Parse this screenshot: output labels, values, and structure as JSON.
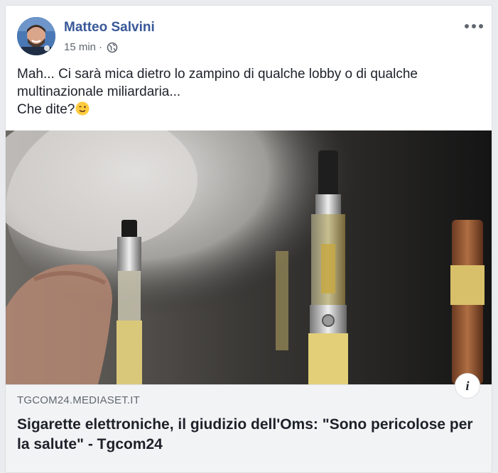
{
  "post": {
    "author": "Matteo Salvini",
    "time": "15 min",
    "separator": "·",
    "privacy_icon": "globe-icon",
    "menu_icon": "more-options-icon",
    "text_lines": [
      "Mah... Ci sarà mica dietro lo zampino di qualche lobby o di qualche",
      "multinazionale miliardaria...",
      "Che dite?"
    ],
    "emoji": "winking-face-emoji"
  },
  "link_preview": {
    "image_icon": "e-cigarette-photo",
    "info_icon": "info-icon",
    "domain": "TGCOM24.MEDIASET.IT",
    "headline": "Sigarette elettroniche, il giudizio dell'Oms: \"Sono pericolose per la salute\" - Tgcom24"
  },
  "colors": {
    "author_link": "#385898",
    "body_text": "#1d2129",
    "meta_text": "#616770",
    "link_box_bg": "#f2f3f5",
    "page_bg": "#e9ebee"
  }
}
